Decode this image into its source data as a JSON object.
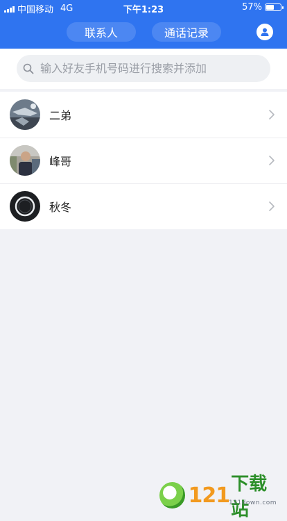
{
  "status_bar": {
    "carrier": "中国移动",
    "network": "4G",
    "time": "下午1:23",
    "battery_percent": "57%",
    "battery_level": 0.57
  },
  "header": {
    "tabs": [
      {
        "label": "联系人"
      },
      {
        "label": "通话记录"
      }
    ],
    "profile_icon": "person-icon"
  },
  "search": {
    "placeholder": "输入好友手机号码进行搜索并添加"
  },
  "contacts": [
    {
      "name": "二弟"
    },
    {
      "name": "峰哥"
    },
    {
      "name": "秋冬"
    }
  ],
  "watermark": {
    "number": "121",
    "text": "下载站",
    "sub": "121down.com"
  },
  "colors": {
    "header_bg": "#2f74f0",
    "page_bg": "#f1f2f6"
  }
}
